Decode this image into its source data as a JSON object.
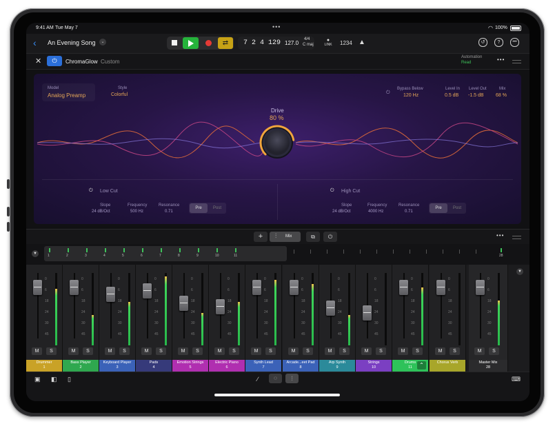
{
  "status_bar": {
    "time": "9:41 AM",
    "date": "Tue May 7",
    "battery": "100%"
  },
  "toolbar": {
    "song_title": "An Evening Song",
    "lcd": {
      "position": "7 2 4 129",
      "tempo": "127.0",
      "signature": "4/4",
      "key": "C maj"
    },
    "link_label": "LINK",
    "count_in": "1234"
  },
  "plugin_header": {
    "plugin_name": "ChromaGlow",
    "preset": "Custom",
    "automation_label": "Automation",
    "automation_value": "Read"
  },
  "plugin": {
    "model_label": "Model",
    "model_value": "Analog Preamp",
    "style_label": "Style",
    "style_value": "Colorful",
    "bypass_label": "Bypass Below",
    "bypass_value": "120 Hz",
    "level_in_label": "Level In",
    "level_in_value": "0.5 dB",
    "level_out_label": "Level Out",
    "level_out_value": "-1.5 dB",
    "mix_label": "Mix",
    "mix_value": "68 %",
    "drive_label": "Drive",
    "drive_value": "80 %",
    "drive_level": 0.8,
    "low_cut": {
      "title": "Low Cut",
      "slope_label": "Slope",
      "slope_value": "24 dB/Oct",
      "freq_label": "Frequency",
      "freq_value": "500 Hz",
      "res_label": "Resonance",
      "res_value": "0.71",
      "pre": "Pre",
      "post": "Post"
    },
    "high_cut": {
      "title": "High Cut",
      "slope_label": "Slope",
      "slope_value": "24 dB/Oct",
      "freq_label": "Frequency",
      "freq_value": "4000 Hz",
      "res_label": "Resonance",
      "res_value": "0.71",
      "pre": "Pre",
      "post": "Post"
    }
  },
  "mix_toolbar": {
    "mix_label": "Mix"
  },
  "overview_numbers": [
    "1",
    "2",
    "3",
    "4",
    "5",
    "6",
    "7",
    "8",
    "9",
    "10",
    "11",
    "28"
  ],
  "scale_labels": [
    "0",
    "6",
    "18",
    "24",
    "30",
    "45"
  ],
  "mute_label": "M",
  "solo_label": "S",
  "channels": [
    {
      "name": "Drummer",
      "num": "1",
      "color": "#c9a227",
      "fader": 0.86,
      "meter": 0.78
    },
    {
      "name": "Bass Player",
      "num": "2",
      "color": "#2fa84f",
      "fader": 0.86,
      "meter": 0.42
    },
    {
      "name": "Keyboard Player",
      "num": "3",
      "color": "#3b62b8",
      "fader": 0.72,
      "meter": 0.6
    },
    {
      "name": "Pads",
      "num": "4",
      "color": "#363a7a",
      "fader": 0.8,
      "meter": 0.95
    },
    {
      "name": "Emotion Strings",
      "num": "5",
      "color": "#b02fb0",
      "fader": 0.55,
      "meter": 0.45
    },
    {
      "name": "Electric Piano",
      "num": "6",
      "color": "#b02fb0",
      "fader": 0.48,
      "meter": 0.6
    },
    {
      "name": "Synth Lead",
      "num": "7",
      "color": "#3b62b8",
      "fader": 0.86,
      "meter": 0.9
    },
    {
      "name": "Arcade...eet Pad",
      "num": "8",
      "color": "#3b62b8",
      "fader": 0.86,
      "meter": 0.85
    },
    {
      "name": "Arp Synth",
      "num": "9",
      "color": "#2b8a9a",
      "fader": 0.45,
      "meter": 0.42
    },
    {
      "name": "Strings",
      "num": "10",
      "color": "#7b3fc2",
      "fader": 0.35,
      "meter": 0.0
    },
    {
      "name": "Drums",
      "num": "11",
      "color": "#2ec25a",
      "fader": 0.86,
      "meter": 0.8
    },
    {
      "name": "Chorus Verb",
      "num": "",
      "color": "#a8a62a",
      "fader": 0.86,
      "meter": 0.0
    },
    {
      "name": "Master Mix",
      "num": "28",
      "color": "#2b2b2d",
      "fader": 0.86,
      "meter": 0.62
    }
  ]
}
